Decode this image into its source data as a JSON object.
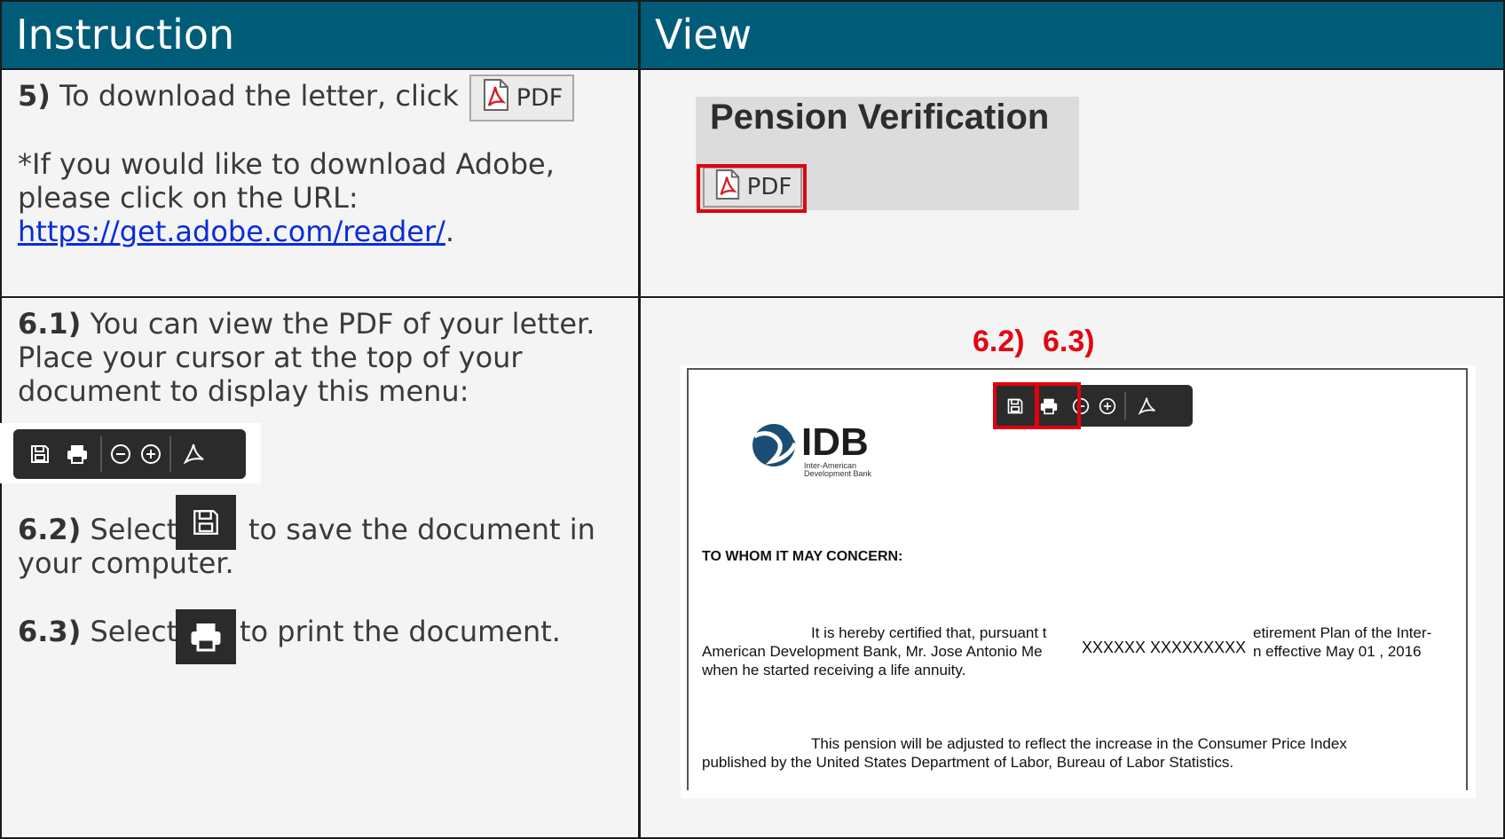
{
  "header": {
    "instruction": "Instruction",
    "view": "View"
  },
  "row1": {
    "step5_num": "5)",
    "step5_text": "To download the letter, click",
    "adobe_line1": "*If you would like to download Adobe,",
    "adobe_line2": "please click on the URL:",
    "url": "https://get.adobe.com/reader/",
    "url_suffix": ".",
    "pdf_button_label": "PDF",
    "view_title": "Pension Verification"
  },
  "row2": {
    "step61_num": "6.1)",
    "step61_line1": "You can view the PDF of your letter.",
    "step61_line2": "Place your cursor at the top of your",
    "step61_line3": "document to display this menu:",
    "step62_num": "6.2)",
    "step62_select": "Select",
    "step62_after": "to save the document in",
    "step62_line2": "your computer.",
    "step63_num": "6.3)",
    "step63_select": "Select",
    "step63_after": "to print the document.",
    "label_62": "6.2)",
    "label_63": "6.3)"
  },
  "document": {
    "logo_text": "IDB",
    "logo_sub1": "Inter-American",
    "logo_sub2": "Development Bank",
    "salutation": "TO WHOM IT MAY CONCERN:",
    "para1_line1_a": "It is hereby certified that, pursuant t",
    "para1_redacted": "XXXXXX XXXXXXXXX",
    "para1_line1_b": "etirement Plan of the Inter-",
    "para1_line2_a": "American Development Bank, Mr. Jose Antonio Me",
    "para1_line2_b": "n effective May 01 , 2016",
    "para1_line3": "when he started receiving a life annuity.",
    "para2_line1": "This pension will be adjusted to reflect the increase in the Consumer Price Index",
    "para2_line2": "published by the United States Department of Labor, Bureau of Labor Statistics."
  },
  "icons": [
    "save-icon",
    "print-icon",
    "zoom-out-icon",
    "zoom-in-icon",
    "adobe-icon",
    "pdf-icon"
  ],
  "colors": {
    "header_bg": "#005c78",
    "highlight_red": "#e1000f",
    "link_blue": "#0b2cd8",
    "toolbar_bg": "#2b2b2b"
  }
}
